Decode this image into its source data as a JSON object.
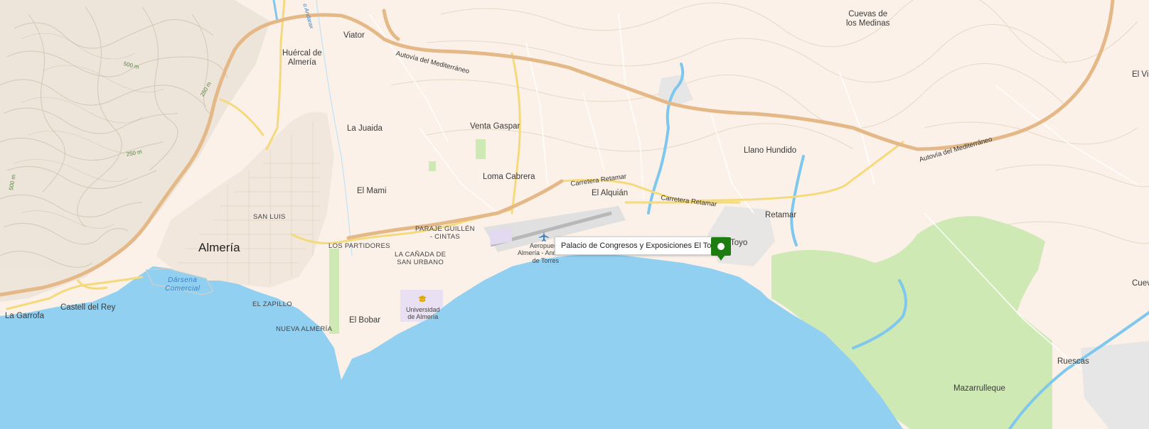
{
  "map": {
    "popup_text": "Palacio de Congresos y Exposiciones El Toyo",
    "pin_color": "#1e7d10",
    "sea_color": "#92d0f2",
    "land_color": "#fbf1e8",
    "park_color": "#cfe9b4",
    "highway_color": "#e5b887",
    "primary_road_color": "#f5da7c",
    "labels": {
      "almeria": "Almería",
      "huercal": "Huércal de\nAlmería",
      "viator": "Viator",
      "cuevas_medinas": "Cuevas de\nlos Medinas",
      "el_viso": "El Vis",
      "cueva": "Cuev",
      "la_juaida": "La Juaida",
      "venta_gaspar": "Venta Gaspar",
      "llano_hundido": "Llano Hundido",
      "loma_cabrera": "Loma Cabrera",
      "el_mami": "El Mami",
      "el_alquian": "El Alquián",
      "retamar": "Retamar",
      "san_luis": "SAN LUIS",
      "paraje_guillen": "PARAJE GUILLÉN\n- CINTAS",
      "los_partidores": "LOS PARTIDORES",
      "la_canada": "LA CAÑADA DE\nSAN URBANO",
      "aeropuerto": "Aeropuerto\nAlmería - Andalucía\nde Torres",
      "toyo": "Toyo",
      "darsena": "Dársena\nComercial",
      "el_zapillo": "EL ZAPILLO",
      "nueva_almeria": "NUEVA ALMERÍA",
      "el_bobar": "El Bobar",
      "universidad": "Universidad\nde Almería",
      "castell_rey": "Castell del Rey",
      "la_garrofa": "La Garrofa",
      "ruescas": "Ruescas",
      "mazarrulleque": "Mazarrulleque",
      "autovia_1": "Autovía del Mediterráneo",
      "autovia_2": "Autovía del Mediterráneo",
      "ctra_retamar_1": "Carretera Retamar",
      "ctra_retamar_2": "Carretera Retamar",
      "rio_andarax": "o Andarax",
      "c500a": "500 m",
      "c250a": "250 m",
      "c250b": "250 m",
      "c500b": "500 m"
    }
  }
}
